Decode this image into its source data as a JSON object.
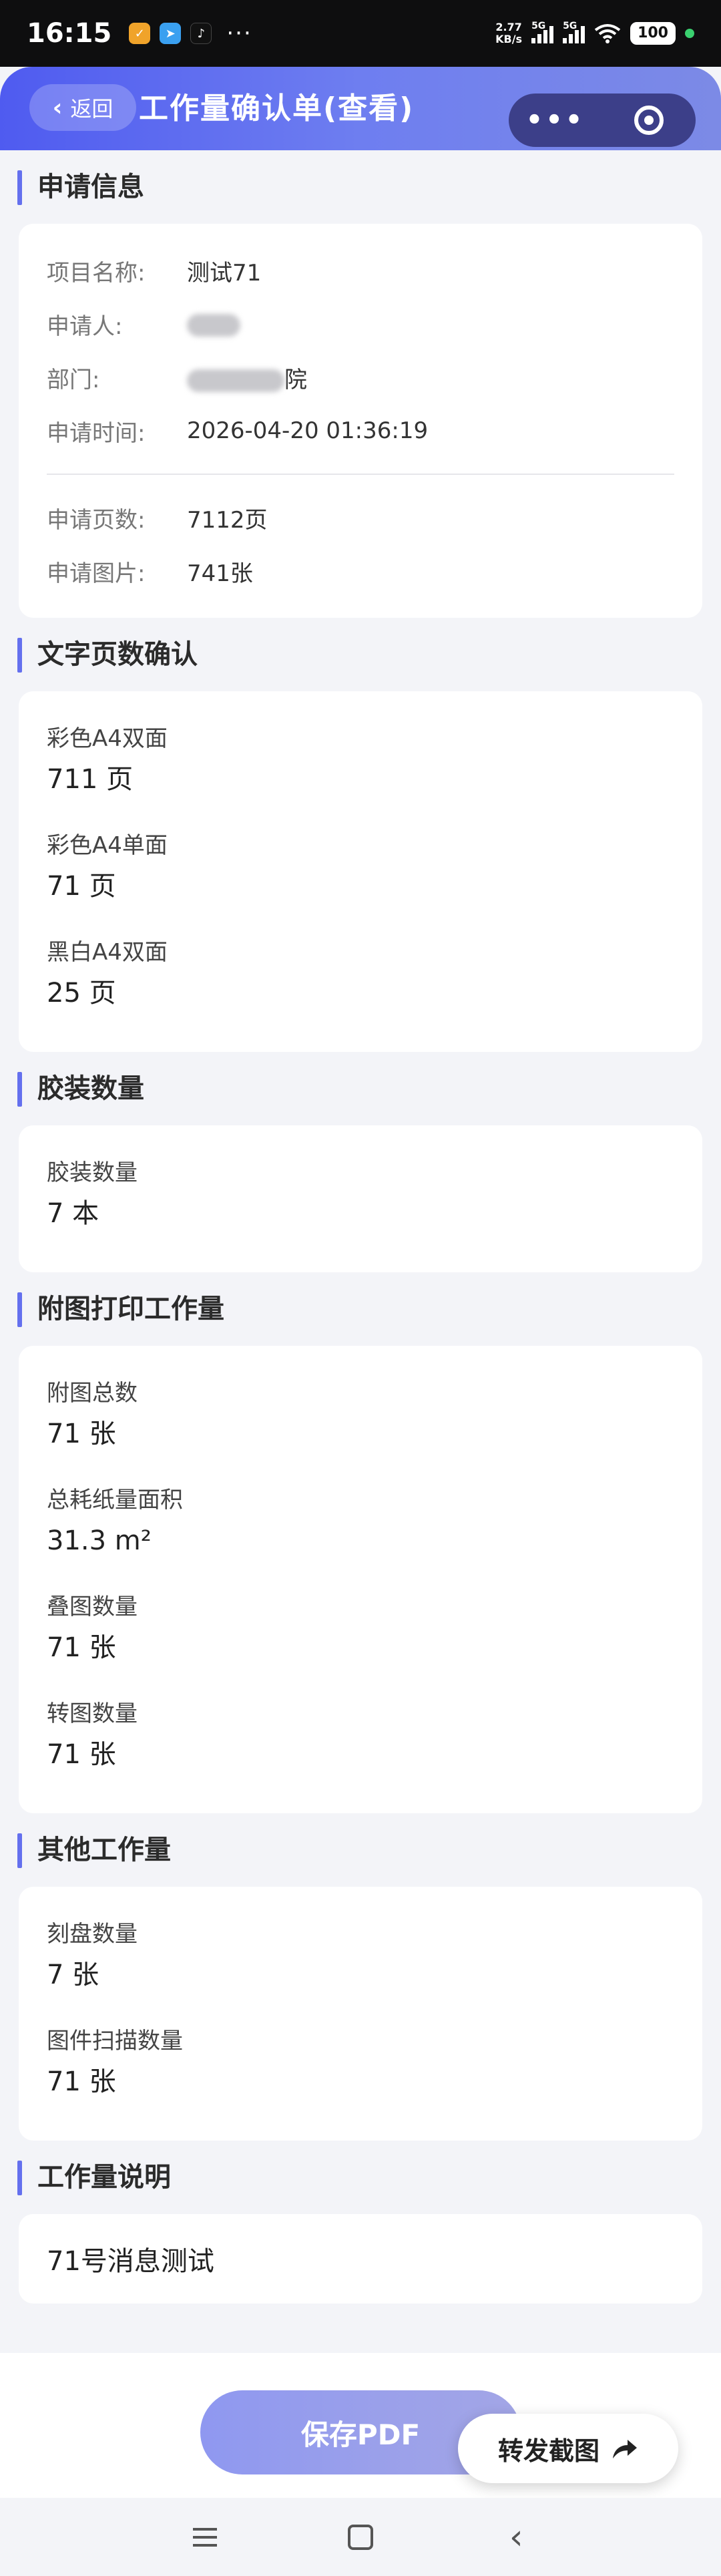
{
  "status_bar": {
    "time": "16:15",
    "net_speed": "2.77",
    "net_unit": "KB/s",
    "signal1": "5G",
    "signal2": "5G",
    "battery": "100"
  },
  "header": {
    "back_label": "返回",
    "title": "工作量确认单(查看)"
  },
  "application_info": {
    "section_title": "申请信息",
    "rows": [
      {
        "label": "项目名称:",
        "value": "测试71"
      },
      {
        "label": "申请人:",
        "value": ""
      },
      {
        "label": "部门:",
        "value": "院"
      },
      {
        "label": "申请时间:",
        "value": "2026-04-20 01:36:19"
      }
    ],
    "rows2": [
      {
        "label": "申请页数:",
        "value": "7112页"
      },
      {
        "label": "申请图片:",
        "value": "741张"
      }
    ]
  },
  "text_pages": {
    "section_title": "文字页数确认",
    "items": [
      {
        "label": "彩色A4双面",
        "value": "711 页"
      },
      {
        "label": "彩色A4单面",
        "value": "71 页"
      },
      {
        "label": "黑白A4双面",
        "value": "25 页"
      }
    ]
  },
  "binding": {
    "section_title": "胶装数量",
    "items": [
      {
        "label": "胶装数量",
        "value": "7 本"
      }
    ]
  },
  "figure_print": {
    "section_title": "附图打印工作量",
    "items": [
      {
        "label": "附图总数",
        "value": "71 张"
      },
      {
        "label": "总耗纸量面积",
        "value": "31.3 m²"
      },
      {
        "label": "叠图数量",
        "value": "71 张"
      },
      {
        "label": "转图数量",
        "value": "71 张"
      }
    ]
  },
  "other_work": {
    "section_title": "其他工作量",
    "items": [
      {
        "label": "刻盘数量",
        "value": "7 张"
      },
      {
        "label": "图件扫描数量",
        "value": "71 张"
      }
    ]
  },
  "work_note": {
    "section_title": "工作量说明",
    "text": "71号消息测试"
  },
  "actions": {
    "save_pdf": "保存PDF",
    "share_screenshot": "转发截图"
  },
  "colors": {
    "accent": "#6470ee",
    "header_gradient_start": "#4f5bf0",
    "header_gradient_end": "#7c8ae6"
  }
}
